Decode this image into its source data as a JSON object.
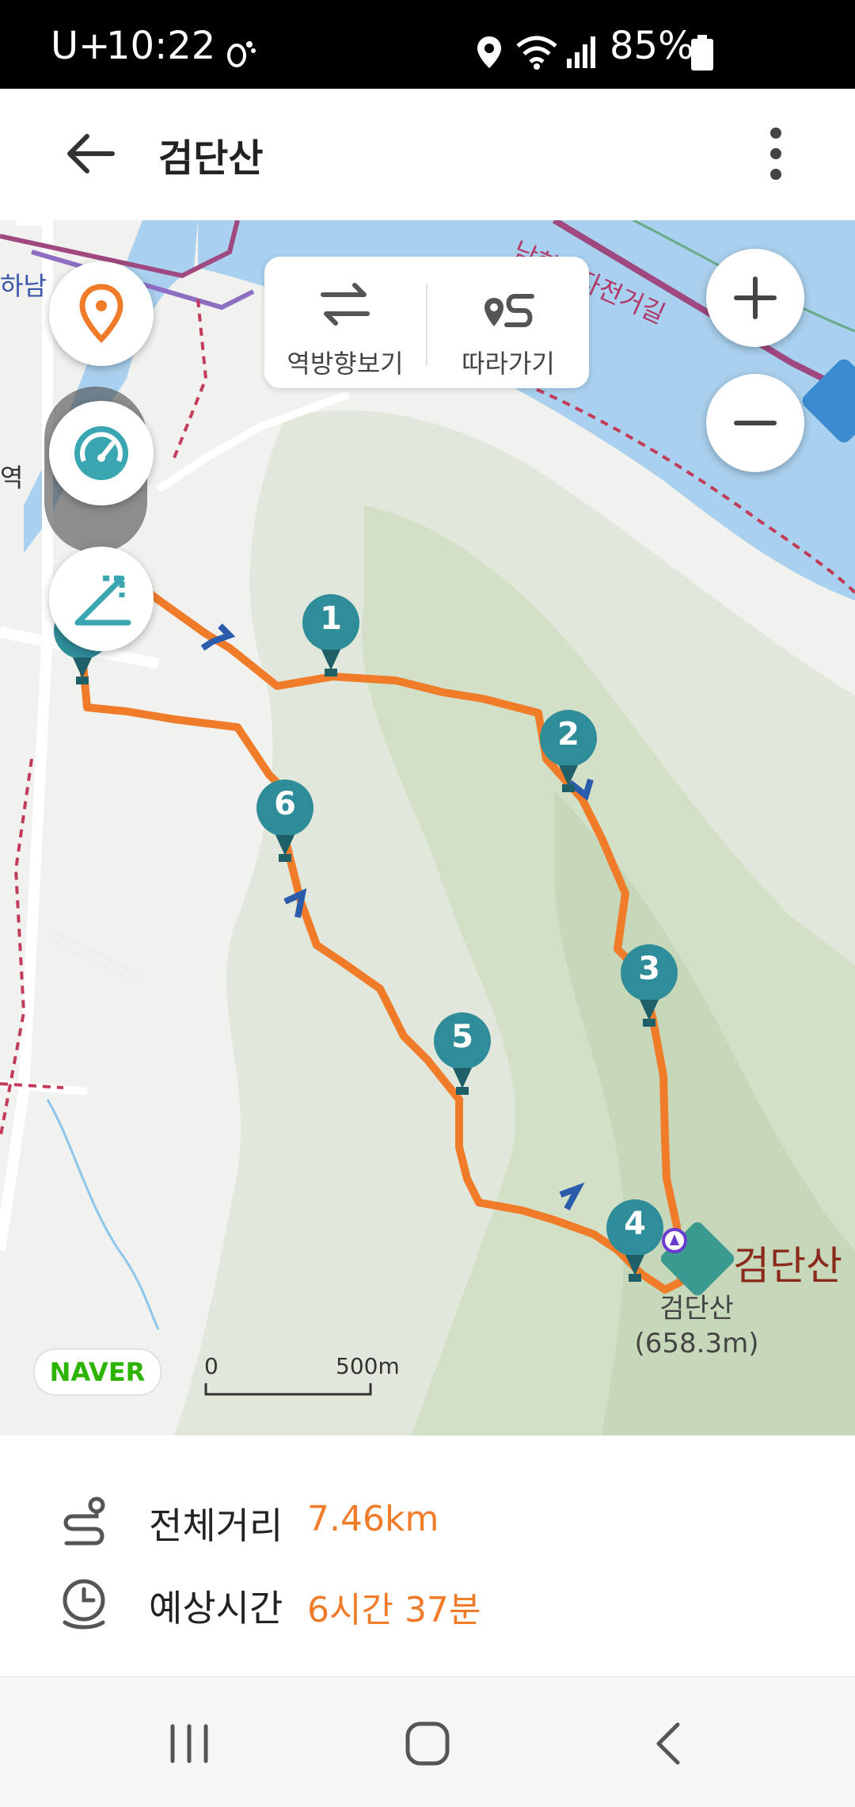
{
  "status_bar": {
    "carrier": "U+",
    "time": "10:22",
    "battery": "85%",
    "icons": [
      "footprint-icon",
      "location-icon",
      "wifi-icon",
      "signal-icon",
      "battery-icon"
    ]
  },
  "header": {
    "title": "검단산",
    "back_icon": "arrow-left-icon",
    "menu_icon": "more-vert-icon"
  },
  "map": {
    "controls": {
      "reverse_label": "역방향보기",
      "follow_label": "따라가기"
    },
    "labels": {
      "river_road": "남한강자전거길",
      "left_top": "하남",
      "left_mid": "역",
      "summit_name": "검단산",
      "summit_sub_1": "검단산",
      "summit_sub_2": "(658.3m)"
    },
    "waypoints": [
      "1",
      "2",
      "3",
      "4",
      "5",
      "6"
    ],
    "naver": "NAVER",
    "scale_start": "0",
    "scale_end": "500m",
    "accent": "#f07c2a",
    "marker_color": "#2f8c99"
  },
  "summary": {
    "distance_label": "전체거리",
    "distance_value": "7.46km",
    "time_label": "예상시간",
    "time_value": "6시간 37분"
  }
}
